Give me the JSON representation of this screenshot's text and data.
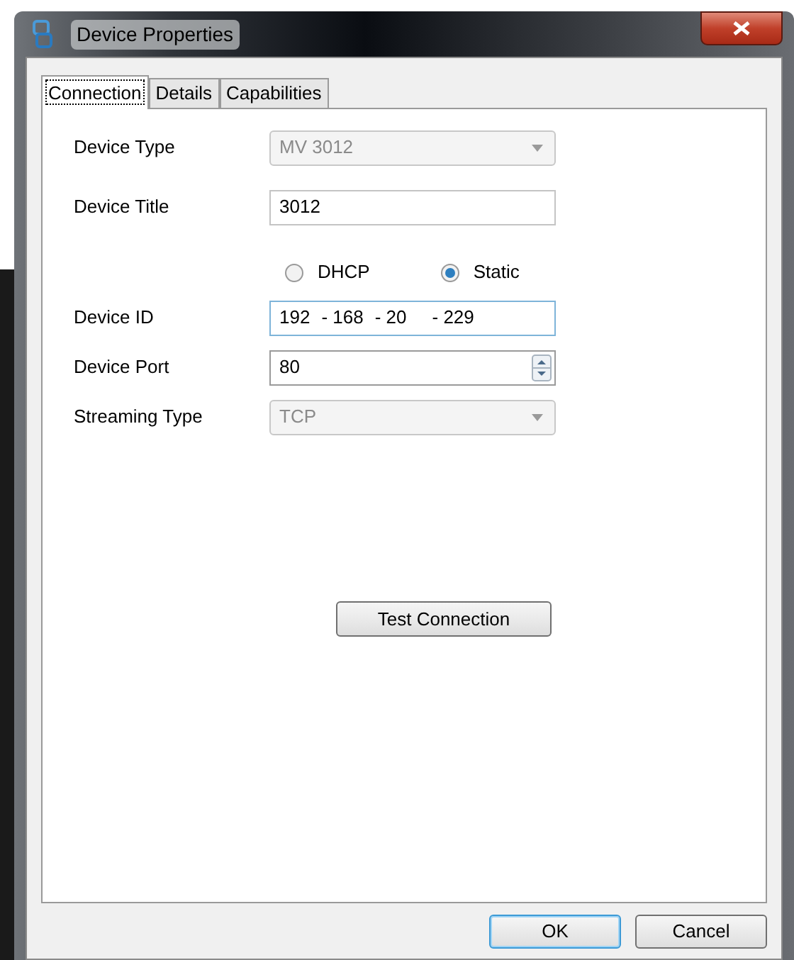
{
  "window": {
    "title": "Device Properties"
  },
  "tabs": [
    {
      "label": "Connection",
      "selected": true
    },
    {
      "label": "Details",
      "selected": false
    },
    {
      "label": "Capabilities",
      "selected": false
    }
  ],
  "fields": [
    {
      "kind": "dropdown",
      "label": "Device Type",
      "value": "MV 3012",
      "disabled": true
    },
    {
      "kind": "text",
      "label": "Device Title",
      "value": "3012"
    },
    {
      "kind": "radios",
      "options": [
        {
          "label": "DHCP",
          "selected": false
        },
        {
          "label": "Static",
          "selected": true
        }
      ]
    },
    {
      "kind": "ip",
      "label": "Device ID",
      "parts": [
        "192",
        "168",
        "20",
        "229"
      ],
      "separator": "-"
    },
    {
      "kind": "spin",
      "label": "Device Port",
      "value": "80"
    },
    {
      "kind": "dropdown",
      "label": "Streaming Type",
      "value": "TCP",
      "disabled": true
    }
  ],
  "test_button": "Test Connection",
  "buttons": [
    {
      "label": "OK",
      "default": true
    },
    {
      "label": "Cancel",
      "default": false
    }
  ]
}
